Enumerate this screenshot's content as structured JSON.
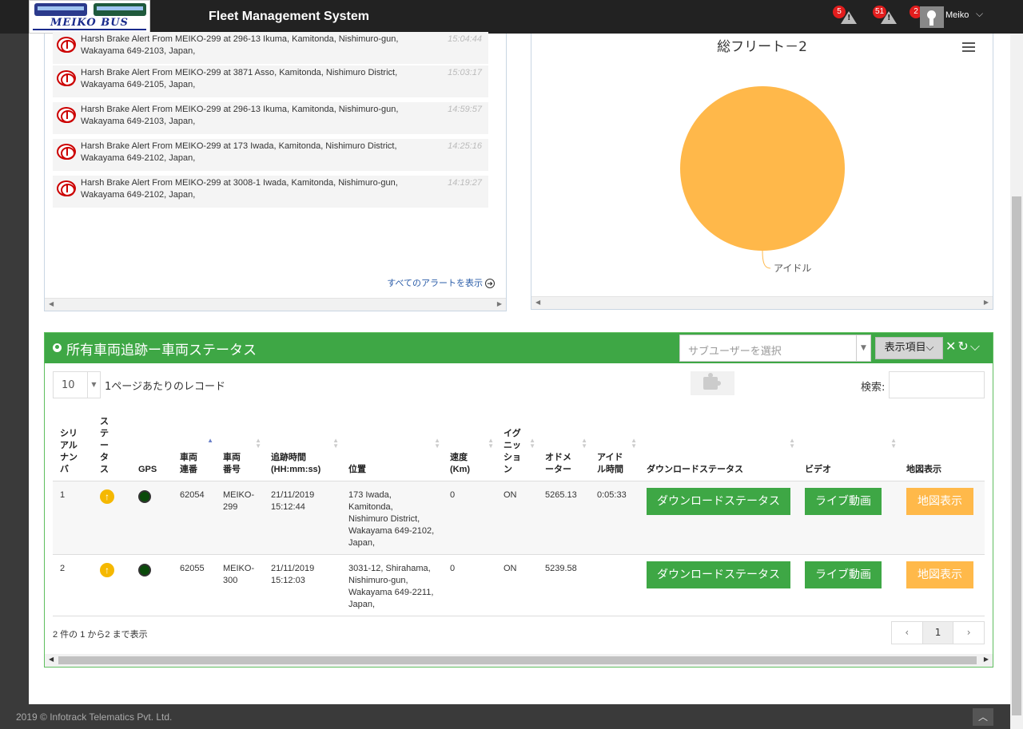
{
  "header": {
    "logo_text": "MEIKO BUS",
    "app_title": "Fleet Management System",
    "notifications": [
      {
        "count": "5",
        "icon": "warning-icon"
      },
      {
        "count": "51",
        "icon": "warning-icon"
      },
      {
        "count": "2",
        "icon": "user-icon"
      }
    ],
    "user_name": "Meiko"
  },
  "alerts": {
    "items": [
      {
        "text": "Harsh Brake Alert From MEIKO-299 at 296-13 Ikuma, Kamitonda, Nishimuro-gun, Wakayama 649-2103, Japan,",
        "time": "15:04:44"
      },
      {
        "text": "Harsh Brake Alert From MEIKO-299 at 3871 Asso, Kamitonda, Nishimuro District, Wakayama 649-2105, Japan,",
        "time": "15:03:17"
      },
      {
        "text": "Harsh Brake Alert From MEIKO-299 at 296-13 Ikuma, Kamitonda, Nishimuro-gun, Wakayama 649-2103, Japan,",
        "time": "14:59:57"
      },
      {
        "text": "Harsh Brake Alert From MEIKO-299 at 173 Iwada, Kamitonda, Nishimuro District, Wakayama 649-2102, Japan,",
        "time": "14:25:16"
      },
      {
        "text": "Harsh Brake Alert From MEIKO-299 at 3008-1 Iwada, Kamitonda, Nishimuro-gun, Wakayama 649-2102, Japan,",
        "time": "14:19:27"
      }
    ],
    "view_all": "すべてのアラートを表示"
  },
  "chart_data": {
    "type": "pie",
    "title": "総フリート－2",
    "slices": [
      {
        "label": "アイドル",
        "value": 2,
        "color": "#ffb84a"
      }
    ]
  },
  "status": {
    "title": "所有車両追跡ー車両ステータス",
    "subuser_placeholder": "サブユーザーを選択",
    "columns_button": "表示項目",
    "page_length": "10",
    "page_length_label": "1ページあたりのレコード",
    "search_label": "検索:",
    "headers": [
      "シリアルナンバ",
      "ステータス",
      "GPS",
      "車両連番",
      "車両番号",
      "追跡時間 (HH:mm:ss)",
      "位置",
      "速度 (Km)",
      "イグニッション",
      "オドメーター",
      "アイドル時間",
      "ダウンロードステータス",
      "ビデオ",
      "地図表示"
    ],
    "rows": [
      {
        "serial": "1",
        "vehicle_seq": "62054",
        "vehicle_no": "MEIKO-299",
        "time": "21/11/2019 15:12:44",
        "location": "173 Iwada, Kamitonda, Nishimuro District, Wakayama 649-2102, Japan,",
        "speed": "0",
        "ignition": "ON",
        "odometer": "5265.13",
        "idle": "0:05:33",
        "download_btn": "ダウンロードステータス",
        "video_btn": "ライブ動画",
        "map_btn": "地図表示"
      },
      {
        "serial": "2",
        "vehicle_seq": "62055",
        "vehicle_no": "MEIKO-300",
        "time": "21/11/2019 15:12:03",
        "location": "3031-12, Shirahama, Nishimuro-gun, Wakayama 649-2211, Japan,",
        "speed": "0",
        "ignition": "ON",
        "odometer": "5239.58",
        "idle": "",
        "download_btn": "ダウンロードステータス",
        "video_btn": "ライブ動画",
        "map_btn": "地図表示"
      }
    ],
    "info": "2 件の 1 から2 まで表示",
    "pager": {
      "prev": "‹",
      "current": "1",
      "next": "›"
    }
  },
  "footer": {
    "copyright": "2019 © Infotrack Telematics Pvt. Ltd."
  },
  "colors": {
    "accent_green": "#3ea745",
    "orange": "#ffb94a",
    "topbar": "#222222",
    "alert_red": "#cc0000"
  }
}
